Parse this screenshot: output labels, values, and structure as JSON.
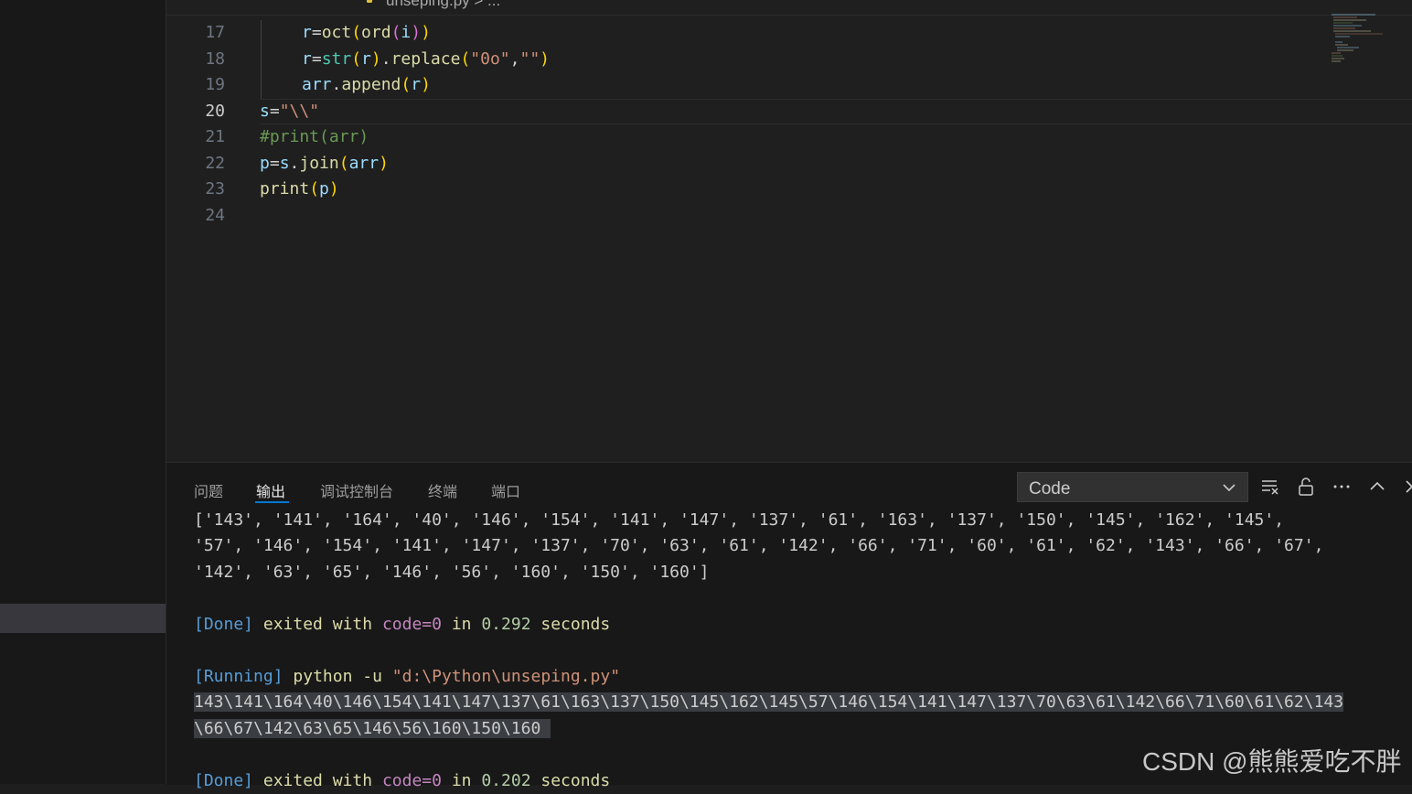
{
  "breadcrumb": {
    "text": "unseping.py > ..."
  },
  "editor": {
    "lines": [
      {
        "num": "17",
        "code": "r=oct(ord(i))"
      },
      {
        "num": "18",
        "code": "r=str(r).replace(\"0o\",\"\")"
      },
      {
        "num": "19",
        "code": "arr.append(r)"
      },
      {
        "num": "20",
        "code": "s=\"\\\\\""
      },
      {
        "num": "21",
        "code": "#print(arr)"
      },
      {
        "num": "22",
        "code": "p=s.join(arr)"
      },
      {
        "num": "23",
        "code": "print(p)"
      },
      {
        "num": "24",
        "code": ""
      }
    ],
    "active_line": "20"
  },
  "panel": {
    "tabs": [
      "问题",
      "输出",
      "调试控制台",
      "终端",
      "端口"
    ],
    "active_tab": "输出",
    "channel": "Code",
    "output": {
      "line1": "['143', '141', '164', '40', '146', '154', '141', '147', '137', '61', '163', '137', '150', '145', '162', '145',",
      "line2": "'57', '146', '154', '141', '147', '137', '70', '63', '61', '142', '66', '71', '60', '61', '62', '143', '66', '67',",
      "line3": "'142', '63', '65', '146', '56', '160', '150', '160']",
      "done1": {
        "tag": "[Done]",
        "text": "exited with",
        "code": "code=0",
        "in": "in",
        "time": "0.292",
        "unit": "seconds"
      },
      "running": {
        "tag": "[Running]",
        "cmd": "python -u",
        "path": "\"d:\\Python\\unseping.py\""
      },
      "result1": "143\\141\\164\\40\\146\\154\\141\\147\\137\\61\\163\\137\\150\\145\\162\\145\\57\\146\\154\\141\\147\\137\\70\\63\\61\\142\\66\\71\\60\\61\\62\\143",
      "result2": "\\66\\67\\142\\63\\65\\146\\56\\160\\150\\160",
      "done2": {
        "tag": "[Done]",
        "text": "exited with",
        "code": "code=0",
        "in": "in",
        "time": "0.202",
        "unit": "seconds"
      }
    }
  },
  "watermark": "CSDN @熊熊爱吃不胖",
  "icons": [
    "python-file-icon",
    "chevron-down-icon",
    "clear-output-icon",
    "lock-icon",
    "more-icon",
    "chevron-up-icon",
    "close-icon"
  ]
}
